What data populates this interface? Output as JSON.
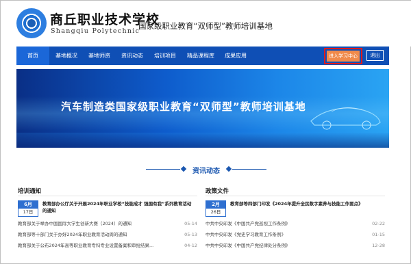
{
  "header": {
    "school_cn": "商丘职业技术学校",
    "school_en": "Shangqiu Polytechnic",
    "base_title": "国家级职业教育“双师型”教师培训基地"
  },
  "nav": {
    "items": [
      "首页",
      "基地概况",
      "基地师资",
      "资讯动态",
      "培训项目",
      "精品课程库",
      "成果应用"
    ],
    "study_center": "进入学习中心",
    "exit": "退出"
  },
  "banner": {
    "title": "汽车制造类国家级职业教育“双师型”教师培训基地"
  },
  "section": {
    "title": "资讯动态"
  },
  "training": {
    "heading": "培训通知",
    "feature": {
      "month": "6月",
      "day": "17日",
      "title": "教育部办公厅关于开展2024年职业学校“技能成才 强国有我”系列教育活动的通知"
    },
    "items": [
      {
        "title": "教育部关于举办中国国际大学生创新大赛（2024）的通知",
        "date": "05-14"
      },
      {
        "title": "教育部等十部门关于办好2024年职业教育活动周的通知",
        "date": "05-13"
      },
      {
        "title": "教育部关于公布2024年高等职业教育专科专业设置备案和审批结果...",
        "date": "04-12"
      }
    ]
  },
  "policy": {
    "heading": "政策文件",
    "feature": {
      "month": "2月",
      "day": "26日",
      "title": "教育部等四部门印发《2024年提升全民数字素养与技能工作要点》"
    },
    "items": [
      {
        "title": "中共中央印发《中国共产党巡视工作条例》",
        "date": "02-22"
      },
      {
        "title": "中共中央印发《党史学习教育工作条例》",
        "date": "01-15"
      },
      {
        "title": "中共中央印发《中国共产党纪律处分条例》",
        "date": "12-28"
      }
    ]
  },
  "colors": {
    "nav_bg": "#0f4fb5",
    "accent": "#f08a4b",
    "highlight_border": "#e21a1a",
    "section_blue": "#1b57b0"
  }
}
